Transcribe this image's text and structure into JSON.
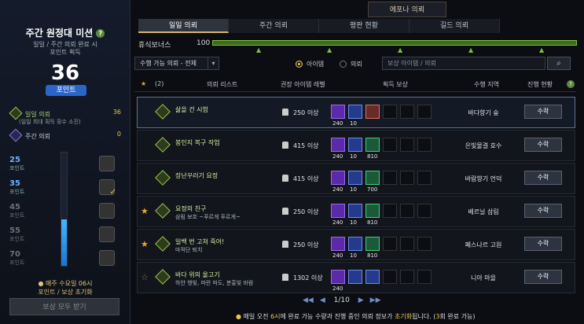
{
  "left": {
    "title": "주간 원정대 미션",
    "desc1": "일일 / 주간 의뢰 완료 시",
    "desc2": "포인트 획득",
    "points": "36",
    "points_label": "포인트",
    "daily_label": "일일 의뢰",
    "daily_value": "36",
    "daily_note": "(일일 최대 획득 횟수 소진)",
    "weekly_label": "주간 의뢰",
    "weekly_value": "0",
    "tiers": [
      {
        "value": "25",
        "unit": "포인트"
      },
      {
        "value": "35",
        "unit": "포인트"
      },
      {
        "value": "45",
        "unit": "포인트"
      },
      {
        "value": "55",
        "unit": "포인트"
      },
      {
        "value": "70",
        "unit": "포인트"
      }
    ],
    "progress_fraction": 0.41,
    "note1": "매주 수요일 06시",
    "note2": "포인트 / 보상 초기화",
    "claim_all": "보상 모두 받기"
  },
  "main": {
    "epona_tab": "에포나 의뢰",
    "tabs": [
      "일일 의뢰",
      "주간 의뢰",
      "평판 현황",
      "길드 의뢰"
    ],
    "rest_label": "휴식보너스",
    "rest_value": "100",
    "filter_value": "수행 가능 의뢰 - 전체",
    "radio_item": "아이템",
    "radio_quest": "의뢰",
    "search_placeholder": "보상 아이템 / 의뢰",
    "head_count": "(2)",
    "head_list": "의뢰 리스트",
    "head_level": "권장 아이템 레벨",
    "head_reward": "획득 보상",
    "head_region": "수행 지역",
    "head_progress": "진행 현황",
    "accept": "수락"
  },
  "quests": [
    {
      "name": "삶을 건 시험",
      "sub": "",
      "level": "250 이상",
      "region": "바다향기 숲",
      "star": "",
      "rewards": [
        "240",
        "10",
        ""
      ],
      "kinds": [
        "p",
        "b",
        "r"
      ]
    },
    {
      "name": "봉인지 복구 작업",
      "sub": "",
      "level": "415 이상",
      "region": "은빛물결 호수",
      "star": "",
      "rewards": [
        "240",
        "10",
        "810"
      ],
      "kinds": [
        "p",
        "b",
        "g"
      ]
    },
    {
      "name": "장난꾸러기 요정",
      "sub": "",
      "level": "415 이상",
      "region": "바람향기 언덕",
      "star": "",
      "rewards": [
        "240",
        "10",
        "700"
      ],
      "kinds": [
        "p",
        "b",
        "g"
      ]
    },
    {
      "name": "요정의 친구",
      "sub": "삼림 보호 ~푸르게 푸르게~",
      "level": "250 이상",
      "region": "베르닐 삼림",
      "star": "★",
      "rewards": [
        "240",
        "10",
        "810"
      ],
      "kinds": [
        "p",
        "b",
        "g"
      ]
    },
    {
      "name": "일백 번 고쳐 죽어!",
      "sub": "마적단 퇴치",
      "level": "250 이상",
      "region": "페스나르 고원",
      "star": "★",
      "rewards": [
        "240",
        "10",
        "810"
      ],
      "kinds": [
        "p",
        "b",
        "g"
      ]
    },
    {
      "name": "바다 위의 울고기",
      "sub": "하얀 햇빛, 파란 파도, 분홍빛 바람",
      "level": "1302 이상",
      "region": "니아 마을",
      "star": "☆",
      "rewards": [
        "240",
        "",
        ""
      ],
      "kinds": [
        "p",
        "b",
        "b"
      ]
    }
  ],
  "pager": {
    "page": "1/10"
  },
  "bottom": {
    "pre": "매일 오전 ",
    "hour": "6시",
    "mid": "에 완료 가능 수량과 진행 중인 의뢰 정보가 ",
    "reset": "초기화",
    "post": "됩니다. (",
    "count": "3",
    "end": "회 완료 가능)"
  }
}
